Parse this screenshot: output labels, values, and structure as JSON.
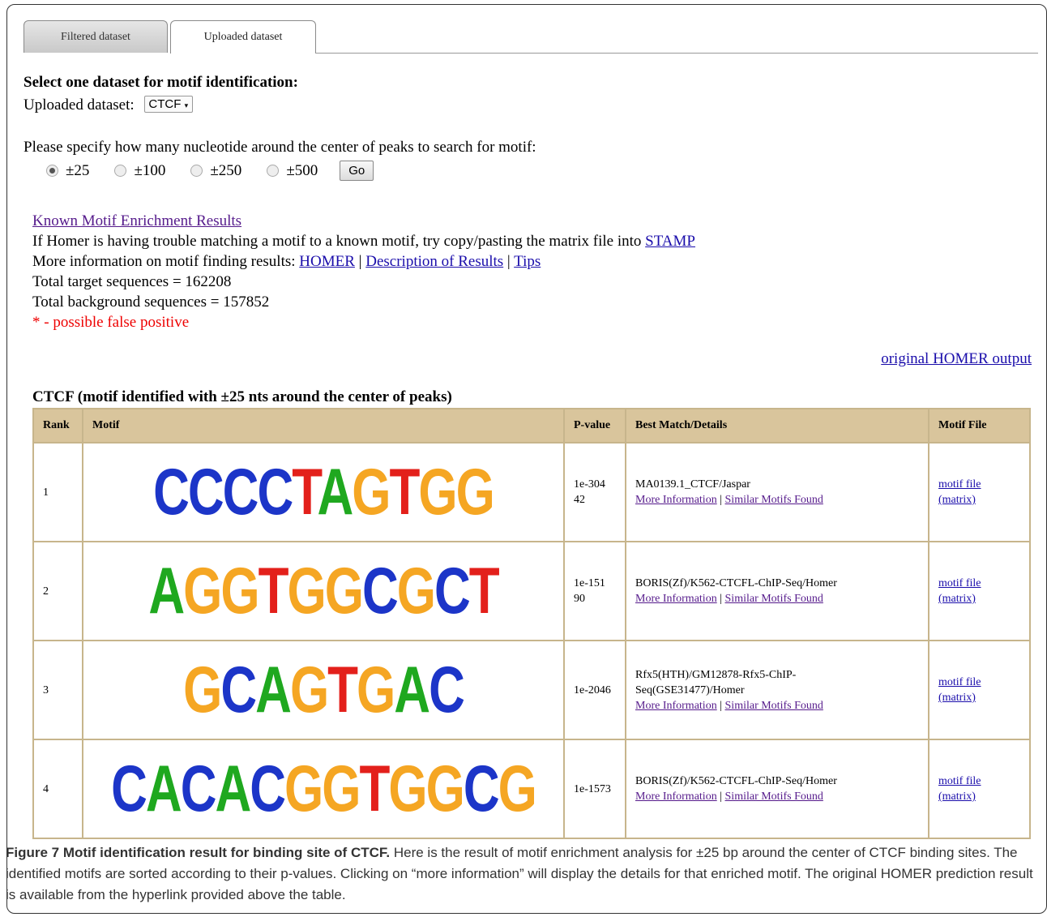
{
  "tabs": [
    "Filtered dataset",
    "Uploaded dataset"
  ],
  "select_heading": "Select one dataset for motif identification:",
  "uploaded_label": "Uploaded dataset:",
  "uploaded_value": "CTCF",
  "specify_text": "Please specify how many nucleotide around the center of peaks to search for motif:",
  "radio_options": [
    "±25",
    "±100",
    "±250",
    "±500"
  ],
  "selected_radio": "±25",
  "go_label": "Go",
  "known_link": "Known Motif Enrichment Results",
  "stamp_prefix": "If Homer is having trouble matching a motif to a known motif, try copy/pasting the matrix file into",
  "stamp_link": "STAMP",
  "more_info_prefix": "More information on motif finding results:",
  "homer_link": "HOMER",
  "desc_link": "Description of Results",
  "tips_link": "Tips",
  "sep": "|",
  "total_target": "Total target sequences = 162208",
  "total_background": "Total background sequences = 157852",
  "false_positive": "* - possible false positive",
  "original_link": "original HOMER output",
  "table_title": "CTCF (motif identified with ±25 nts around the center of peaks)",
  "headers": [
    "Rank",
    "Motif",
    "P-value",
    "Best Match/Details",
    "Motif File"
  ],
  "rows": [
    {
      "rank": "1",
      "motif": "CCCCTAGTGG",
      "pvalue": "1e-30442",
      "match": "MA0139.1_CTCF/Jaspar",
      "more": "More Information",
      "similar": "Similar Motifs Found",
      "file": "motif file",
      "matrix": "(matrix)"
    },
    {
      "rank": "2",
      "motif": "AGGTGGCGCT",
      "pvalue": "1e-15190",
      "match": "BORIS(Zf)/K562-CTCFL-ChIP-Seq/Homer",
      "more": "More Information",
      "similar": "Similar Motifs Found",
      "file": "motif file",
      "matrix": "(matrix)"
    },
    {
      "rank": "3",
      "motif": "GCAGTGAC",
      "pvalue": "1e-2046",
      "match": "Rfx5(HTH)/GM12878-Rfx5-ChIP-Seq(GSE31477)/Homer",
      "more": "More Information",
      "similar": "Similar Motifs Found",
      "file": "motif file",
      "matrix": "(matrix)"
    },
    {
      "rank": "4",
      "motif": "CACACGGTGGCG",
      "pvalue": "1e-1573",
      "match": "BORIS(Zf)/K562-CTCFL-ChIP-Seq/Homer",
      "more": "More Information",
      "similar": "Similar Motifs Found",
      "file": "motif file",
      "matrix": "(matrix)"
    }
  ],
  "caption_bold": "Figure 7 Motif identification result for binding site of CTCF.",
  "caption_text": "Here is the result of motif enrichment analysis for ±25 bp around the center of CTCF binding sites. The identified motifs are sorted according to their p-values. Clicking on “more information” will display the details for that enriched motif. The original HOMER prediction result is available from the hyperlink provided above the table.",
  "base_colors": {
    "A": "#1fa81f",
    "C": "#1c35c8",
    "G": "#f5a623",
    "T": "#e3201b"
  }
}
